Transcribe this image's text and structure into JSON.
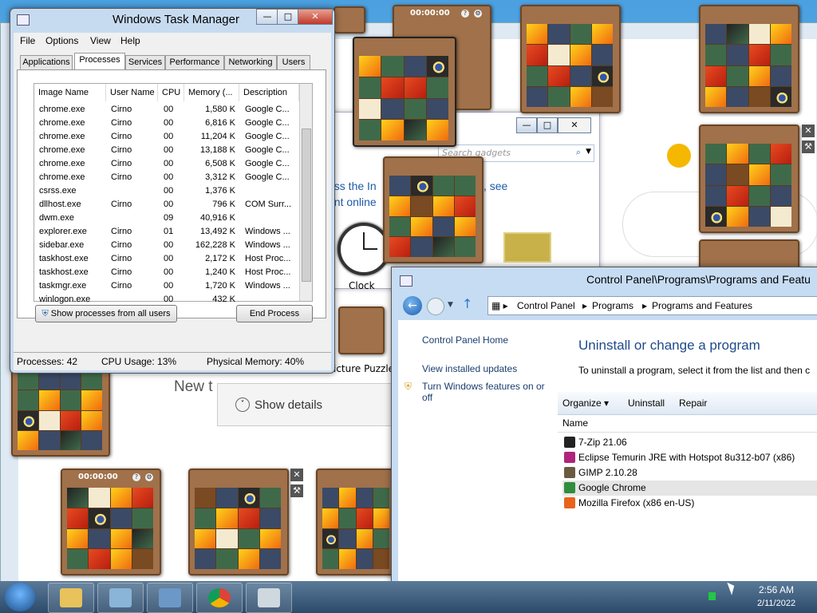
{
  "desktop": {
    "chrome_page_text": "New t",
    "gallery": {
      "search_placeholder": "Search gadgets",
      "info_text_line1": "ess the In",
      "info_text_line1b": "formation, see",
      "info_text_line2": "ent online",
      "clock_label": "Clock",
      "picture_puzzle_label": "icture Puzzle"
    },
    "show_details_label": "Show details",
    "puzzle_timer": "00:00:00"
  },
  "task_manager": {
    "title": "Windows Task Manager",
    "menu": [
      "File",
      "Options",
      "View",
      "Help"
    ],
    "tabs": [
      "Applications",
      "Processes",
      "Services",
      "Performance",
      "Networking",
      "Users"
    ],
    "active_tab": "Processes",
    "columns": [
      "Image Name",
      "User Name",
      "CPU",
      "Memory (...",
      "Description"
    ],
    "rows": [
      {
        "image": "chrome.exe",
        "user": "Cirno",
        "cpu": "00",
        "mem": "1,580 K",
        "desc": "Google C..."
      },
      {
        "image": "chrome.exe",
        "user": "Cirno",
        "cpu": "00",
        "mem": "6,816 K",
        "desc": "Google C..."
      },
      {
        "image": "chrome.exe",
        "user": "Cirno",
        "cpu": "00",
        "mem": "11,204 K",
        "desc": "Google C..."
      },
      {
        "image": "chrome.exe",
        "user": "Cirno",
        "cpu": "00",
        "mem": "13,188 K",
        "desc": "Google C..."
      },
      {
        "image": "chrome.exe",
        "user": "Cirno",
        "cpu": "00",
        "mem": "6,508 K",
        "desc": "Google C..."
      },
      {
        "image": "chrome.exe",
        "user": "Cirno",
        "cpu": "00",
        "mem": "3,312 K",
        "desc": "Google C..."
      },
      {
        "image": "csrss.exe",
        "user": "",
        "cpu": "00",
        "mem": "1,376 K",
        "desc": ""
      },
      {
        "image": "dllhost.exe",
        "user": "Cirno",
        "cpu": "00",
        "mem": "796 K",
        "desc": "COM Surr..."
      },
      {
        "image": "dwm.exe",
        "user": "",
        "cpu": "09",
        "mem": "40,916 K",
        "desc": ""
      },
      {
        "image": "explorer.exe",
        "user": "Cirno",
        "cpu": "01",
        "mem": "13,492 K",
        "desc": "Windows ..."
      },
      {
        "image": "sidebar.exe",
        "user": "Cirno",
        "cpu": "00",
        "mem": "162,228 K",
        "desc": "Windows ..."
      },
      {
        "image": "taskhost.exe",
        "user": "Cirno",
        "cpu": "00",
        "mem": "2,172 K",
        "desc": "Host Proc..."
      },
      {
        "image": "taskhost.exe",
        "user": "Cirno",
        "cpu": "00",
        "mem": "1,240 K",
        "desc": "Host Proc..."
      },
      {
        "image": "taskmgr.exe",
        "user": "Cirno",
        "cpu": "00",
        "mem": "1,720 K",
        "desc": "Windows ..."
      },
      {
        "image": "winlogon.exe",
        "user": "",
        "cpu": "00",
        "mem": "432 K",
        "desc": ""
      }
    ],
    "show_all_label": "Show processes from all users",
    "end_process_label": "End Process",
    "status_processes": "Processes: 42",
    "status_cpu": "CPU Usage: 13%",
    "status_memory": "Physical Memory: 40%"
  },
  "control_panel": {
    "title": "Control Panel\\Programs\\Programs and Featu",
    "breadcrumbs": [
      "Control Panel",
      "Programs",
      "Programs and Features"
    ],
    "left_links": [
      "Control Panel Home",
      "View installed updates",
      "Turn Windows features on or",
      "off"
    ],
    "heading": "Uninstall or change a program",
    "description": "To uninstall a program, select it from the list and then c",
    "toolbar": [
      "Organize ▾",
      "Uninstall",
      "Repair"
    ],
    "column_name": "Name",
    "programs": [
      {
        "name": "7-Zip 21.06",
        "icon": "7zip-icon",
        "color": "#222222"
      },
      {
        "name": "Eclipse Temurin JRE with Hotspot 8u312-b07 (x86)",
        "icon": "temurin-icon",
        "color": "#b0247c"
      },
      {
        "name": "GIMP 2.10.28",
        "icon": "gimp-icon",
        "color": "#6a5a40"
      },
      {
        "name": "Google Chrome",
        "icon": "chrome-icon",
        "color": "#2f8e3c"
      },
      {
        "name": "Mozilla Firefox (x86 en-US)",
        "icon": "firefox-icon",
        "color": "#e8641a"
      }
    ],
    "selected_program": "Google Chrome"
  },
  "taskbar": {
    "time": "2:56 AM",
    "date": "2/11/2022",
    "apps": [
      "explorer-icon",
      "control-panel-icon",
      "remote-desktop-icon",
      "chrome-icon",
      "task-manager-icon"
    ]
  }
}
